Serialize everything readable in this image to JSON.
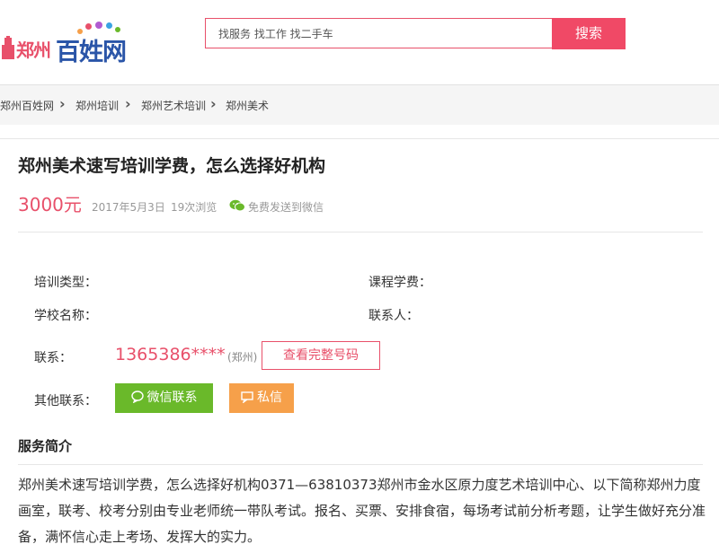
{
  "header": {
    "logo_city": "郑州",
    "logo_brand": "百姓网",
    "search_placeholder": "找服务 找工作 找二手车",
    "search_button": "搜索"
  },
  "breadcrumb": [
    "郑州百姓网",
    "郑州培训",
    "郑州艺术培训",
    "郑州美术"
  ],
  "listing": {
    "title": "郑州美术速写培训学费，怎么选择好机构",
    "price": "3000元",
    "date": "2017年5月3日",
    "views": "19次浏览",
    "send_wechat": "免费发送到微信"
  },
  "details": {
    "training_type_label": "培训类型：",
    "tuition_label": "课程学费：",
    "school_label": "学校名称：",
    "contact_person_label": "联系人："
  },
  "contact": {
    "label": "联系：",
    "phone": "1365386****",
    "phone_location": "(郑州)",
    "view_full_button": "查看完整号码",
    "other_label": "其他联系：",
    "wechat_button": "微信联系",
    "message_button": "私信"
  },
  "service": {
    "heading": "服务简介",
    "text": "郑州美术速写培训学费，怎么选择好机构0371—63810373郑州市金水区原力度艺术培训中心、以下简称郑州力度画室，联考、校考分别由专业老师统一带队考试。报名、买票、安排食宿，每场考试前分析考题，让学生做好充分准备，满怀信心走上考场、发挥大的实力。"
  },
  "colors": {
    "accent": "#e8506a",
    "brand_blue": "#2a55a8",
    "wechat_green": "#6ab92a",
    "message_orange": "#f6a04a"
  }
}
